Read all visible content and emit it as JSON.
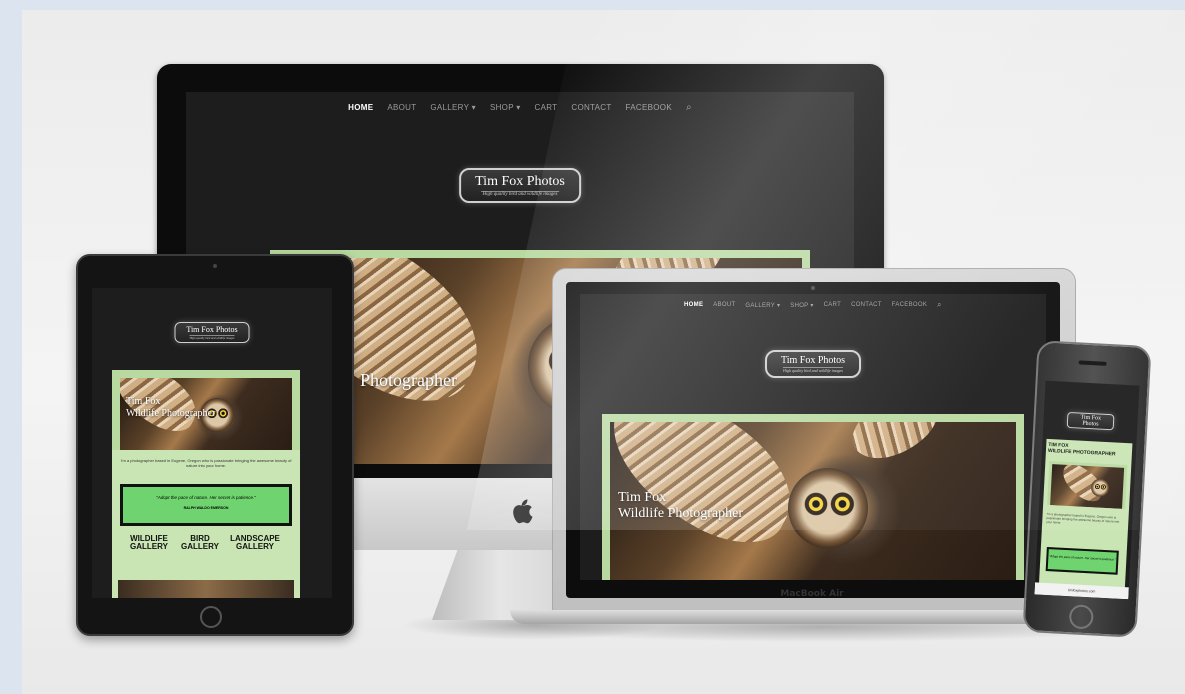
{
  "nav": {
    "home": "HOME",
    "about": "ABOUT",
    "gallery": "GALLERY ▾",
    "shop": "SHOP ▾",
    "cart": "CART",
    "contact": "CONTACT",
    "facebook": "FACEBOOK"
  },
  "logo": {
    "title": "Tim Fox Photos",
    "tagline": "High quality bird and wildlife images"
  },
  "hero": {
    "line1": "Tim Fox",
    "line2": "Wildlife Photographer",
    "partial": "Photographer"
  },
  "intro": "I'm a photographer based in Eugene, Oregon who is passionate bringing the awesome beauty of nature into your home.",
  "quote": {
    "text": "\"Adopt the pace of nature. Her secret is patience.\"",
    "author": "RALPH WALDO EMERSON",
    "short": "\"Adopt the pace of nature. Her secret is patience.\""
  },
  "galleries": {
    "wildlife": "WILDLIFE GALLERY",
    "bird": "BIRD GALLERY",
    "landscape": "LANDSCAPE GALLERY"
  },
  "phone": {
    "heading_1": "TIM FOX",
    "heading_2": "WILDLIFE PHOTOGRAPHER",
    "url": "timfoxphotos.com"
  },
  "device": {
    "macbook_label": "MacBook Air",
    "apple_logo": ""
  },
  "colors": {
    "accent_green": "#6fd36f",
    "frame_green": "#b8d9a0",
    "screen_bg": "#1d1d1d"
  },
  "icons": {
    "search": "search-icon",
    "apple": "apple-logo-icon"
  }
}
